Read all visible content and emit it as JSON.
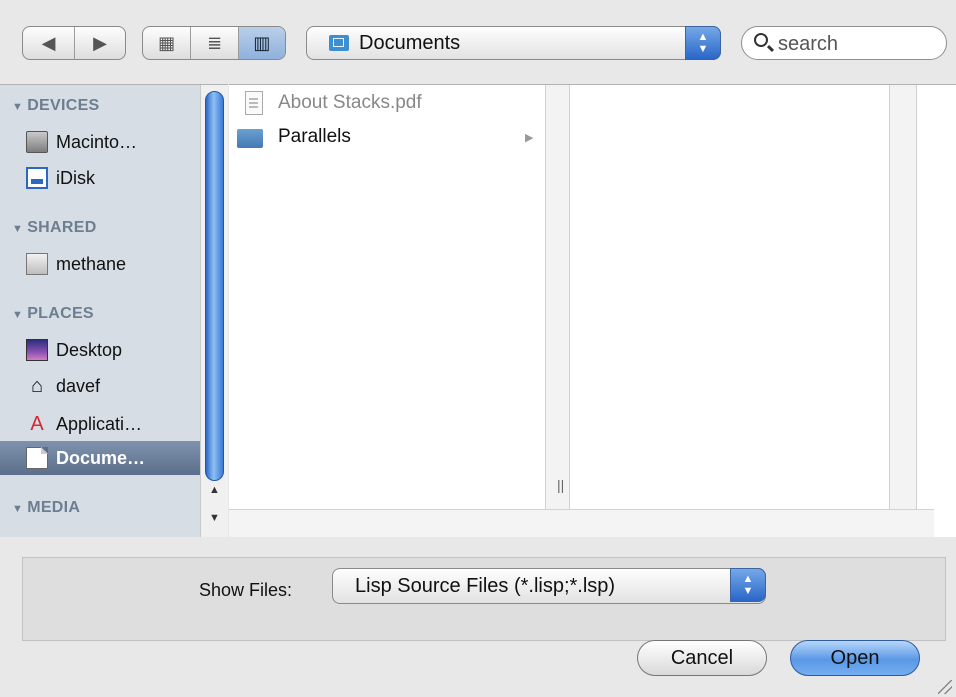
{
  "toolbar": {
    "back_glyph": "◀",
    "forward_glyph": "▶",
    "view_icon_glyph": "▦",
    "view_list_glyph": "≣",
    "view_column_glyph": "▥",
    "path_popup": {
      "label": "Documents",
      "icon": "folder-icon"
    },
    "search": {
      "placeholder": "search"
    },
    "active_view": "column"
  },
  "sidebar": {
    "sections": [
      {
        "title": "DEVICES"
      },
      {
        "title": "SHARED"
      },
      {
        "title": "PLACES"
      },
      {
        "title": "MEDIA"
      }
    ],
    "items": [
      {
        "label": "Macinto…",
        "icon": "hard-drive-icon"
      },
      {
        "label": "iDisk",
        "icon": "idisk-icon"
      },
      {
        "label": "methane",
        "icon": "shared-computer-icon"
      },
      {
        "label": "Desktop",
        "icon": "desktop-icon"
      },
      {
        "label": "davef",
        "icon": "home-icon"
      },
      {
        "label": "Applicati…",
        "icon": "applications-icon"
      },
      {
        "label": "Docume…",
        "icon": "documents-icon",
        "selected": true
      }
    ]
  },
  "browser": {
    "column1": [
      {
        "name": "About Stacks.pdf",
        "icon": "pdf-file-icon",
        "enabled": false
      },
      {
        "name": "Parallels",
        "icon": "folder-icon",
        "enabled": true,
        "has_children": true
      }
    ]
  },
  "filter": {
    "label": "Show Files:",
    "selected": "Lisp Source Files (*.lisp;*.lsp)"
  },
  "buttons": {
    "cancel": "Cancel",
    "open": "Open"
  },
  "colors": {
    "accent": "#3b7ad4",
    "sidebar_bg": "#d6dde5",
    "selection": "#6b7f9c"
  }
}
